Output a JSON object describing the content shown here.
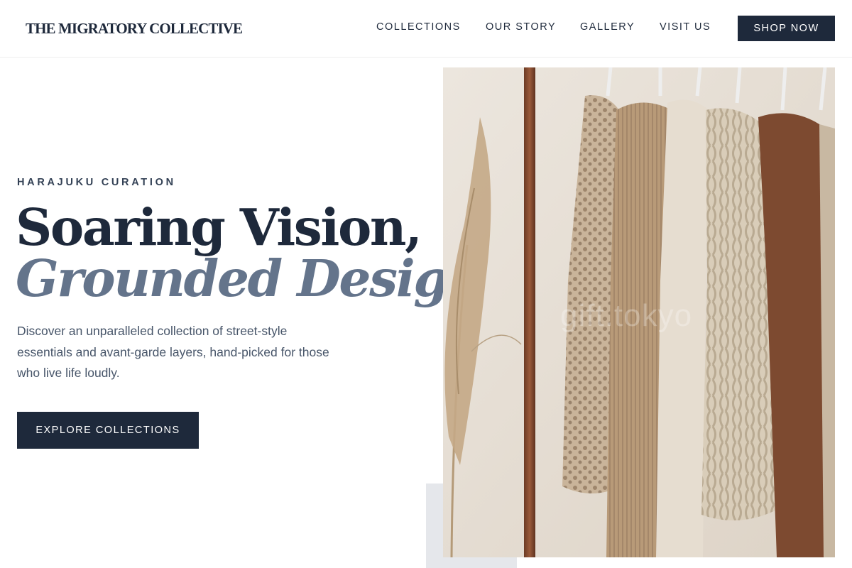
{
  "brand": {
    "name": "THE MIGRATORY COLLECTIVE"
  },
  "nav": {
    "items": [
      {
        "label": "COLLECTIONS"
      },
      {
        "label": "OUR STORY"
      },
      {
        "label": "GALLERY"
      },
      {
        "label": "VISIT US"
      }
    ],
    "cta_label": "SHOP NOW"
  },
  "hero": {
    "eyebrow": "HARAJUKU CURATION",
    "headline_line1": "Soaring Vision,",
    "headline_line2": "Grounded Design.",
    "description": "Discover an unparalleled collection of street-style essentials and avant-garde layers, hand-picked for those who live life loudly.",
    "cta_label": "EXPLORE COLLECTIONS",
    "image": {
      "subject": "clothing rack with neutral-toned knitwear and dried pampas grass",
      "watermark": "gift.tokyo"
    }
  },
  "colors": {
    "primary": "#1e293b",
    "accent_text": "#64748b",
    "body_text": "#475569",
    "accent_block": "#e5e7eb"
  }
}
